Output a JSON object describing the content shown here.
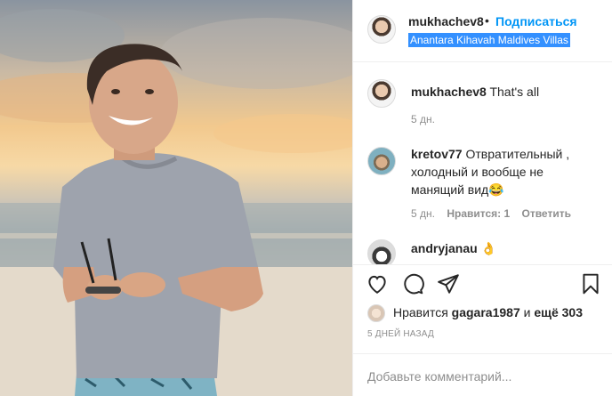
{
  "post": {
    "username": "mukhachev8",
    "separator": "•",
    "follow_label": "Подписаться",
    "location": "Anantara Kihavah Maldives Villas"
  },
  "comments": [
    {
      "username": "mukhachev8",
      "text": "That's all",
      "age": "5 дн."
    },
    {
      "username": "kretov77",
      "text": "Отвратительный , холодный и вообще не манящий вид😂",
      "age": "5 дн.",
      "likes": "Нравится: 1",
      "reply_label": "Ответить"
    },
    {
      "username": "andryjanau",
      "text": "👌"
    }
  ],
  "actions": {
    "like_icon": "heart-icon",
    "comment_icon": "comment-icon",
    "share_icon": "share-icon",
    "save_icon": "bookmark-icon"
  },
  "likes": {
    "prefix": "Нравится",
    "user": "gagara1987",
    "connector": "и",
    "more": "ещё 303"
  },
  "timestamp": "5 ДНЕЙ НАЗАД",
  "add_comment": {
    "placeholder": "Добавьте комментарий..."
  },
  "colors": {
    "link_blue": "#0095f6",
    "selection": "#3390ff",
    "muted": "#8e8e8e"
  }
}
